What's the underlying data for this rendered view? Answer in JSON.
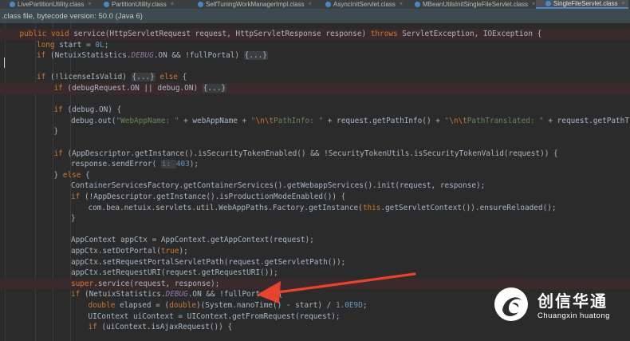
{
  "tabs": [
    {
      "label": "LivePartitionUtility.class",
      "active": false
    },
    {
      "label": "PartitionUtility.class",
      "active": false
    },
    {
      "label": "SelfTuningWorkManagerImpl.class",
      "active": false
    },
    {
      "label": "AsyncInitServlet.class",
      "active": false
    },
    {
      "label": "MBeanUtilsInitSingleFileServlet.class",
      "active": false
    },
    {
      "label": "SingleFileServlet.class",
      "active": true
    }
  ],
  "info_bar": {
    "text": ".class file, bytecode version: 50.0 (Java 6)"
  },
  "code_lines": [
    {
      "indent": 2,
      "err": true,
      "tokens": [
        [
          "kw",
          "public void "
        ],
        [
          "",
          "service(HttpServletRequest request, HttpServletResponse response) "
        ],
        [
          "kw",
          "throws "
        ],
        [
          "",
          "ServletException, IOException {"
        ]
      ]
    },
    {
      "indent": 4,
      "tokens": [
        [
          "kw",
          "long "
        ],
        [
          "",
          "start = "
        ],
        [
          "num",
          "0L"
        ],
        [
          "",
          ";"
        ]
      ]
    },
    {
      "indent": 4,
      "tokens": [
        [
          "kw",
          "if "
        ],
        [
          "",
          "(NetuixStatistics."
        ],
        [
          "itf",
          "DEBUG"
        ],
        [
          "",
          ".ON && !fullPortal) "
        ],
        [
          "fold",
          "{...}"
        ]
      ]
    },
    {
      "indent": 0,
      "tokens": []
    },
    {
      "indent": 4,
      "tokens": [
        [
          "kw",
          "if "
        ],
        [
          "",
          "(!licenseIsValid) "
        ],
        [
          "fold",
          "{...}"
        ],
        [
          "kw",
          " else "
        ],
        [
          "",
          "{"
        ]
      ]
    },
    {
      "indent": 6,
      "err": true,
      "tokens": [
        [
          "kw",
          "if "
        ],
        [
          "",
          "(debugRequest.ON || debug.ON) "
        ],
        [
          "fold",
          "{...}"
        ]
      ]
    },
    {
      "indent": 0,
      "tokens": []
    },
    {
      "indent": 6,
      "tokens": [
        [
          "kw",
          "if "
        ],
        [
          "",
          "(debug.ON) {"
        ]
      ]
    },
    {
      "indent": 8,
      "tokens": [
        [
          "",
          "debug.out("
        ],
        [
          "str",
          "\"WebAppName: \""
        ],
        [
          "",
          " + webAppName + "
        ],
        [
          "str",
          "\""
        ],
        [
          "esc",
          "\\n\\t"
        ],
        [
          "str",
          "PathInfo: \""
        ],
        [
          "",
          " + request.getPathInfo() + "
        ],
        [
          "str",
          "\""
        ],
        [
          "esc",
          "\\n\\t"
        ],
        [
          "str",
          "PathTranslated: \""
        ],
        [
          "",
          " + request.getPathTranslat"
        ]
      ]
    },
    {
      "indent": 6,
      "tokens": [
        [
          "",
          "}"
        ]
      ]
    },
    {
      "indent": 0,
      "tokens": []
    },
    {
      "indent": 6,
      "tokens": [
        [
          "kw",
          "if "
        ],
        [
          "",
          "(AppDescriptor.getInstance().isSecurityTokenEnabled() && !SecurityTokenUtils.isSecurityTokenValid(request)) {"
        ]
      ]
    },
    {
      "indent": 8,
      "tokens": [
        [
          "",
          "response.sendError( "
        ],
        [
          "hint",
          "i: "
        ],
        [
          "num",
          "403"
        ],
        [
          "",
          ");"
        ]
      ]
    },
    {
      "indent": 6,
      "tokens": [
        [
          "",
          "} "
        ],
        [
          "kw",
          "else "
        ],
        [
          "",
          "{"
        ]
      ]
    },
    {
      "indent": 8,
      "tokens": [
        [
          "",
          "ContainerServicesFactory.getContainerServices().getWebappServices().init(request, response);"
        ]
      ]
    },
    {
      "indent": 8,
      "tokens": [
        [
          "kw",
          "if "
        ],
        [
          "",
          "(!AppDescriptor.getInstance().isProductionModeEnabled()) {"
        ]
      ]
    },
    {
      "indent": 10,
      "tokens": [
        [
          "",
          "com.bea.netuix.servlets.util.WebAppPaths.Factory.getInstance("
        ],
        [
          "kw",
          "this"
        ],
        [
          "",
          ".getServletContext()).ensureReloaded();"
        ]
      ]
    },
    {
      "indent": 8,
      "tokens": [
        [
          "",
          "}"
        ]
      ]
    },
    {
      "indent": 0,
      "tokens": []
    },
    {
      "indent": 8,
      "tokens": [
        [
          "",
          "AppContext appCtx = AppContext.getAppContext(request);"
        ]
      ]
    },
    {
      "indent": 8,
      "tokens": [
        [
          "",
          "appCtx.setDotPortal("
        ],
        [
          "kw",
          "true"
        ],
        [
          "",
          ");"
        ]
      ]
    },
    {
      "indent": 8,
      "tokens": [
        [
          "",
          "appCtx.setRequestPortalServletPath(request.getServletPath());"
        ]
      ]
    },
    {
      "indent": 8,
      "tokens": [
        [
          "",
          "appCtx.setRequestURI(request.getRequestURI());"
        ]
      ]
    },
    {
      "indent": 8,
      "err": true,
      "tokens": [
        [
          "kw",
          "super"
        ],
        [
          "",
          ".service(request, response);"
        ]
      ]
    },
    {
      "indent": 8,
      "tokens": [
        [
          "kw",
          "if "
        ],
        [
          "",
          "(NetuixStatistics."
        ],
        [
          "itf",
          "DEBUG"
        ],
        [
          "",
          ".ON && !fullPortal) {"
        ]
      ]
    },
    {
      "indent": 10,
      "tokens": [
        [
          "kw",
          "double "
        ],
        [
          "",
          "elapsed = ("
        ],
        [
          "kw",
          "double"
        ],
        [
          "",
          ")(System.nanoTime() - start) / "
        ],
        [
          "num",
          "1.0E9D"
        ],
        [
          "",
          ";"
        ]
      ]
    },
    {
      "indent": 10,
      "tokens": [
        [
          "",
          "UIContext uiContext = UIContext.getFromRequest(request);"
        ]
      ]
    },
    {
      "indent": 10,
      "tokens": [
        [
          "kw",
          "if "
        ],
        [
          "",
          "(uiContext.isAjaxRequest()) {"
        ]
      ]
    }
  ],
  "logo": {
    "cn": "创信华通",
    "en": "Chuangxin huatong"
  },
  "colors": {
    "keyword": "#cc7832",
    "number": "#6897bb",
    "string": "#6a8759",
    "text": "#a9b7c6",
    "arrow": "#e8432f"
  },
  "icons": [
    "class-file-icon",
    "close-icon",
    "logo-mark-icon",
    "arrow-annotation"
  ]
}
